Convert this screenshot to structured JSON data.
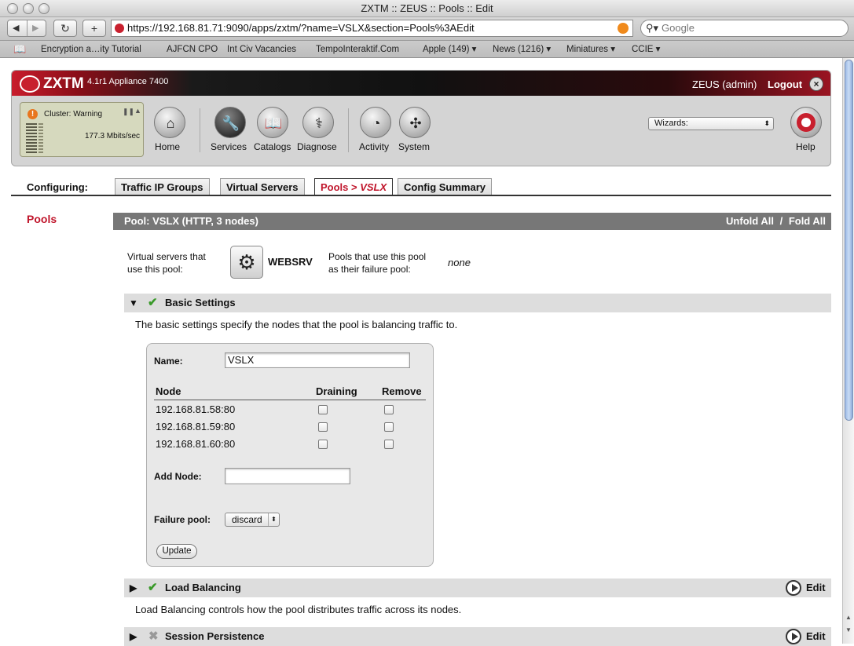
{
  "browser": {
    "window_title": "ZXTM :: ZEUS :: Pools :: Edit",
    "url": "https://192.168.81.71:9090/apps/zxtm/?name=VSLX&section=Pools%3AEdit",
    "search_placeholder": "Google",
    "bookmarks": [
      "Encryption a…ity Tutorial",
      "AJFCN CPO",
      "Int Civ Vacancies",
      "TempoInteraktif.Com",
      "Apple (149) ▾",
      "News (1216) ▾",
      "Miniatures ▾",
      "CCIE ▾"
    ]
  },
  "app": {
    "logo": "ZXTM",
    "version": "4.1r1 Appliance 7400",
    "user": "ZEUS (admin)",
    "logout": "Logout",
    "cluster_status": "Cluster: Warning",
    "throughput": "177.3 Mbits/sec",
    "nav": {
      "home": "Home",
      "services": "Services",
      "catalogs": "Catalogs",
      "diagnose": "Diagnose",
      "activity": "Activity",
      "system": "System",
      "help": "Help"
    },
    "wizards_select": "Wizards:"
  },
  "tabs": {
    "configuring_label": "Configuring:",
    "traffic_ip_groups": "Traffic IP Groups",
    "virtual_servers": "Virtual Servers",
    "pools_prefix": "Pools > ",
    "pools_current": "VSLX",
    "config_summary": "Config Summary"
  },
  "sidebar": {
    "pools": "Pools"
  },
  "pool": {
    "header": "Pool: VSLX (HTTP, 3 nodes)",
    "unfold_all": "Unfold All",
    "separator": "/",
    "fold_all": "Fold All",
    "vs_label_line1": "Virtual servers that",
    "vs_label_line2": "use this pool:",
    "vs_name": "WEBSRV",
    "failure_label_line1": "Pools that use this pool",
    "failure_label_line2": "as their failure pool:",
    "failure_value": "none"
  },
  "basic": {
    "title": "Basic Settings",
    "description": "The basic settings specify the nodes that the pool is balancing traffic to.",
    "name_label": "Name:",
    "name_value": "VSLX",
    "col_node": "Node",
    "col_draining": "Draining",
    "col_remove": "Remove",
    "nodes": [
      "192.168.81.58:80",
      "192.168.81.59:80",
      "192.168.81.60:80"
    ],
    "add_node_label": "Add Node:",
    "failure_pool_label": "Failure pool:",
    "failure_pool_value": "discard",
    "update_button": "Update"
  },
  "load_balancing": {
    "title": "Load Balancing",
    "description": "Load Balancing controls how the pool distributes traffic across its nodes.",
    "edit": "Edit"
  },
  "session_persistence": {
    "title": "Session Persistence",
    "edit": "Edit"
  },
  "colors": {
    "brand_red": "#c0152b",
    "check_green": "#3a9a2a",
    "header_gray": "#777777"
  }
}
